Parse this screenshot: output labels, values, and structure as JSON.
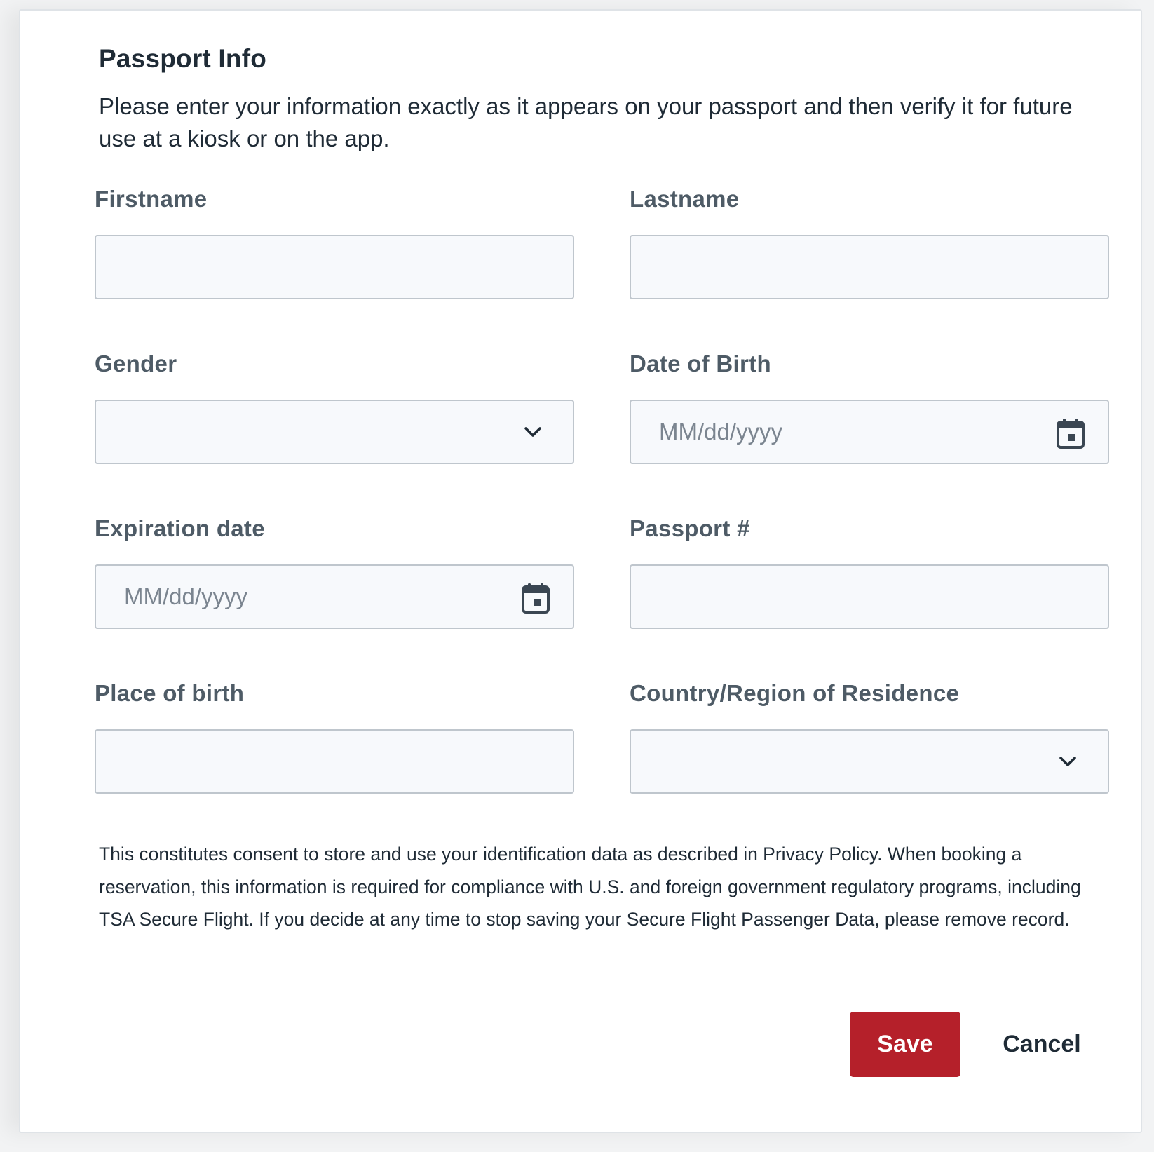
{
  "form": {
    "title": "Passport Info",
    "subtitle": "Please enter your information exactly as it appears on your passport and then verify it for future use at a kiosk or on the app.",
    "fields": {
      "firstname": {
        "label": "Firstname",
        "value": ""
      },
      "lastname": {
        "label": "Lastname",
        "value": ""
      },
      "gender": {
        "label": "Gender",
        "selected": ""
      },
      "dob": {
        "label": "Date of Birth",
        "placeholder": "MM/dd/yyyy"
      },
      "expiration": {
        "label": "Expiration date",
        "placeholder": "MM/dd/yyyy"
      },
      "passport_number": {
        "label": "Passport #",
        "value": ""
      },
      "place_of_birth": {
        "label": "Place of birth",
        "value": ""
      },
      "residence": {
        "label": "Country/Region of Residence",
        "selected": ""
      }
    },
    "consent": "This constitutes consent to store and use your identification data as described in Privacy Policy. When booking a reservation, this information is required for compliance with U.S. and foreign government regulatory programs, including TSA Secure Flight. If you decide at any time to stop saving your Secure Flight Passenger Data, please remove record.",
    "actions": {
      "save_label": "Save",
      "cancel_label": "Cancel"
    }
  },
  "icons": {
    "dropdown": "chevron-down-icon",
    "date": "calendar-icon"
  },
  "colors": {
    "primary_button": "#b5202a",
    "label_text": "#4e5b66",
    "field_background": "#f7f9fc",
    "field_border": "#bfc6cd"
  }
}
